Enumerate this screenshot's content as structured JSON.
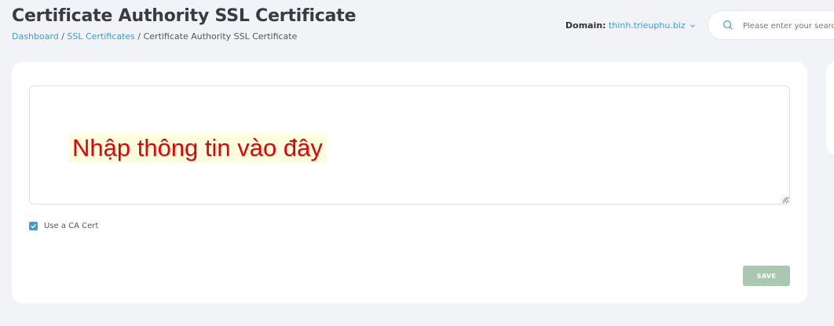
{
  "header": {
    "title": "Certificate Authority SSL Certificate",
    "breadcrumb": {
      "dashboard": "Dashboard",
      "ssl": "SSL Certificates",
      "current": "Certificate Authority SSL Certificate",
      "separator": "/"
    }
  },
  "domain": {
    "label": "Domain:",
    "value": "thinh.trieuphu.biz"
  },
  "search": {
    "placeholder": "Please enter your search"
  },
  "form": {
    "hint_text": "Nhập thông tin vào đây",
    "use_ca_label": "Use a CA Cert",
    "use_ca_checked": true,
    "save_label": "SAVE"
  },
  "colors": {
    "accent": "#3e9bd6",
    "hint_text": "#e60000",
    "hint_background": "#ffffe0",
    "save_button": "#a8c9b0"
  },
  "icons": {
    "search": "search-icon",
    "chevron": "chevron-down-icon",
    "check": "check-icon"
  }
}
